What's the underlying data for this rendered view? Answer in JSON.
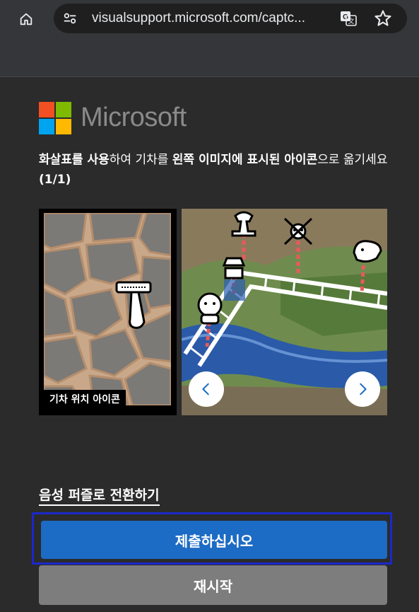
{
  "browser": {
    "url": "visualsupport.microsoft.com/captc...",
    "icons": [
      "home-icon",
      "site-info-icon",
      "translate-icon",
      "star-icon"
    ]
  },
  "brand": {
    "name": "Microsoft"
  },
  "captcha": {
    "instruction_part1": "화살표를 사용",
    "instruction_part2": "하여 기차를 ",
    "instruction_part3": "왼쪽 이미지에 표시된 아이콘",
    "instruction_part4": "으로 옮기세요 ",
    "progress": "(1/1)",
    "left_caption": "기차 위치 아이콘",
    "prev_icon": "chevron-left-icon",
    "next_icon": "chevron-right-icon"
  },
  "actions": {
    "audio_link": "음성 퍼즐로 전환하기",
    "submit": "제출하십시오",
    "reset": "재시작"
  },
  "colors": {
    "page_bg": "#2b2b2b",
    "submit_bg": "#1c6bc4",
    "submit_focus_border": "#1b28c9",
    "reset_bg": "#7d7d7d"
  }
}
